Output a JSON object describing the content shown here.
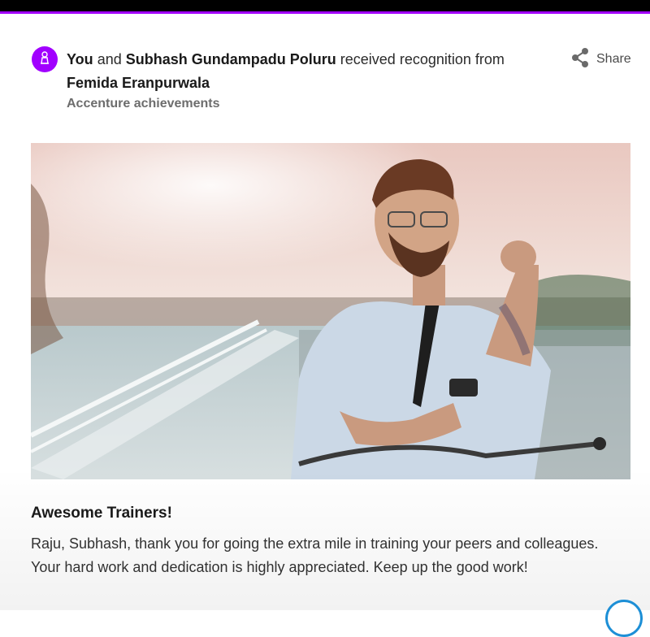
{
  "header": {
    "you": "You",
    "and": "and",
    "colleague": "Subhash Gundampadu Poluru",
    "received": "received recognition from",
    "giver": "Femida Eranpurwala",
    "program": "Accenture achievements"
  },
  "share": {
    "label": "Share",
    "icon": "share-icon"
  },
  "avatar": {
    "icon": "award-icon"
  },
  "hero": {
    "icon": "photo"
  },
  "content": {
    "title": "Awesome Trainers!",
    "message": "Raju, Subhash, thank you for going the extra mile in training your peers and colleagues. Your hard work and dedication is highly appreciated. Keep up the good work!"
  },
  "colors": {
    "brand": "#a100ff",
    "text": "#1a1a1a",
    "muted": "#6d6d6d"
  }
}
